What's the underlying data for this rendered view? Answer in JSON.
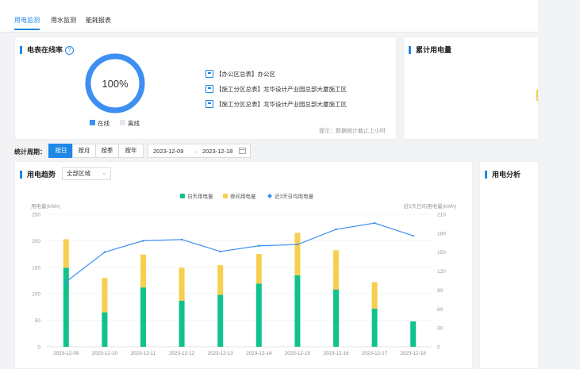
{
  "tabs": [
    {
      "label": "用电监测",
      "active": true
    },
    {
      "label": "用水监测",
      "active": false
    },
    {
      "label": "能耗报表",
      "active": false
    }
  ],
  "online_card": {
    "title": "电表在线率",
    "help": "?",
    "rate_label": "100%",
    "online_rate": 1.0,
    "legend": [
      {
        "label": "在线",
        "color": "#3d8ff2"
      },
      {
        "label": "离线",
        "color": "#e3e8f0"
      }
    ],
    "meters": [
      {
        "tag": "【办公区总表】",
        "name": "办公区"
      },
      {
        "tag": "【施工分区总表】",
        "name": "龙华设计产业园总部大厦施工区"
      },
      {
        "tag": "【施工分区总表】",
        "name": "龙华设计产业园总部大厦施工区"
      }
    ],
    "hint": "提示：数据统计截止上小时"
  },
  "cumulative_card": {
    "title": "累计用电量"
  },
  "filter": {
    "label": "统计周期：",
    "buttons": [
      {
        "label": "按日",
        "active": true
      },
      {
        "label": "按月",
        "active": false
      },
      {
        "label": "按季",
        "active": false
      },
      {
        "label": "按年",
        "active": false
      }
    ],
    "start_date": "2023-12-09",
    "sep": "→",
    "end_date": "2023-12-18",
    "calendar_icon": "calendar-icon"
  },
  "trend_card": {
    "title": "用电趋势",
    "region_select": "全部区域"
  },
  "analysis_card": {
    "title": "用电分析"
  },
  "chart_data": {
    "type": "bar",
    "categories": [
      "2023-12-09",
      "2023-12-10",
      "2023-12-11",
      "2023-12-12",
      "2023-12-13",
      "2023-12-14",
      "2023-12-15",
      "2023-12-16",
      "2023-12-17",
      "2023-12-18"
    ],
    "series": [
      {
        "name": "白天用电量",
        "type": "bar",
        "stack": "a",
        "color": "#12c28c",
        "values": [
          149,
          65,
          112,
          87,
          98,
          119,
          135,
          108,
          72,
          48
        ]
      },
      {
        "name": "夜间用电量",
        "type": "bar",
        "stack": "a",
        "color": "#f7cf4f",
        "values": [
          54,
          65,
          62,
          62,
          56,
          56,
          80,
          74,
          50,
          0
        ]
      },
      {
        "name": "近3天日均用电量",
        "type": "line",
        "axis": "right",
        "color": "#3d8ff2",
        "values": [
          103,
          150,
          168,
          170,
          151,
          160,
          162,
          186,
          196,
          176
        ]
      }
    ],
    "ylabel_left": "用电量(kWh)",
    "ylabel_right": "近3天日均用电量(kWh)",
    "ylim_left": [
      0,
      250
    ],
    "yticks_left": [
      0,
      50,
      100,
      150,
      200,
      250
    ],
    "ylim_right": [
      0,
      210
    ],
    "yticks_right": [
      0,
      30,
      60,
      90,
      120,
      150,
      180,
      210
    ],
    "grid": true,
    "legend_position": "top"
  }
}
